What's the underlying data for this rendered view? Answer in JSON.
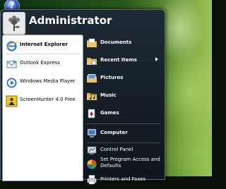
{
  "start_menu": {
    "user_name": "Administrator",
    "pinned": [
      {
        "label": "Internet Explorer",
        "icon": "internet-explorer-icon",
        "bold": true
      },
      {
        "label": "Outlook Express",
        "icon": "outlook-express-icon",
        "bold": false
      },
      {
        "label": "Windows Media Player",
        "icon": "media-player-icon",
        "bold": false
      },
      {
        "label": "ScreenHunter 4.0 Free",
        "icon": "screenhunter-icon",
        "bold": false
      }
    ],
    "places": [
      {
        "label": "Documents",
        "icon": "documents-folder-icon"
      },
      {
        "label": "Recent Items",
        "icon": "recent-items-folder-icon",
        "has_submenu": true
      },
      {
        "label": "Pictures",
        "icon": "pictures-folder-icon"
      },
      {
        "label": "Music",
        "icon": "music-folder-icon"
      },
      {
        "label": "Games",
        "icon": "games-icon"
      },
      {
        "label": "Computer",
        "icon": "computer-icon"
      },
      {
        "label": "Control Panel",
        "icon": "control-panel-icon"
      },
      {
        "label": "Set Program Access and Defaults",
        "icon": "program-defaults-icon"
      },
      {
        "label": "Printers and Faxes",
        "icon": "printer-icon"
      }
    ]
  },
  "colors": {
    "menu_bg": "#1e2a35",
    "left_pane_bg": "#ffffff",
    "text_light": "#ffffff",
    "orb": "#3a63c7"
  }
}
